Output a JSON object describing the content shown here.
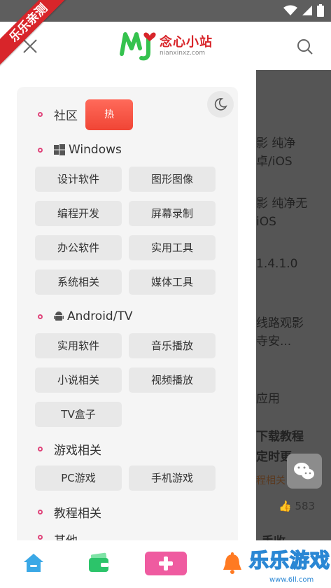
{
  "ribbon": "乐乐亲测",
  "header": {
    "logo_cn": "念心小站",
    "logo_en": "nianxinxz.com"
  },
  "menu": {
    "community": {
      "label": "社区",
      "badge": "热"
    },
    "windows": {
      "label": "Windows",
      "tags": [
        "设计软件",
        "图形图像",
        "编程开发",
        "屏幕录制",
        "办公软件",
        "实用工具",
        "系统相关",
        "媒体工具"
      ]
    },
    "android": {
      "label": "Android/TV",
      "tags": [
        "实用软件",
        "音乐播放",
        "小说相关",
        "视频播放",
        "TV盒子"
      ]
    },
    "games": {
      "label": "游戏相关",
      "tags": [
        "PC游戏",
        "手机游戏"
      ]
    },
    "tutorials": {
      "label": "教程相关"
    },
    "other": {
      "label": "其他"
    }
  },
  "background": {
    "line1": "影 纯净",
    "line2": "卓/iOS",
    "line3": "影 纯净无",
    "line4": "iOS",
    "line5": "1.4.1.0",
    "line6": "线路观影",
    "line7": "寺安...",
    "line8": "应用",
    "line9": "下载教程",
    "line10": "定时更",
    "line11": "程相关",
    "likes": "583",
    "line12": "手收"
  },
  "watermark": {
    "text": "乐乐游戏",
    "url": "www.6ll.com"
  },
  "colors": {
    "accent": "#e0457b",
    "hot": "#f04535",
    "brand_green": "#35c24e",
    "brand_red": "#d8252a"
  }
}
